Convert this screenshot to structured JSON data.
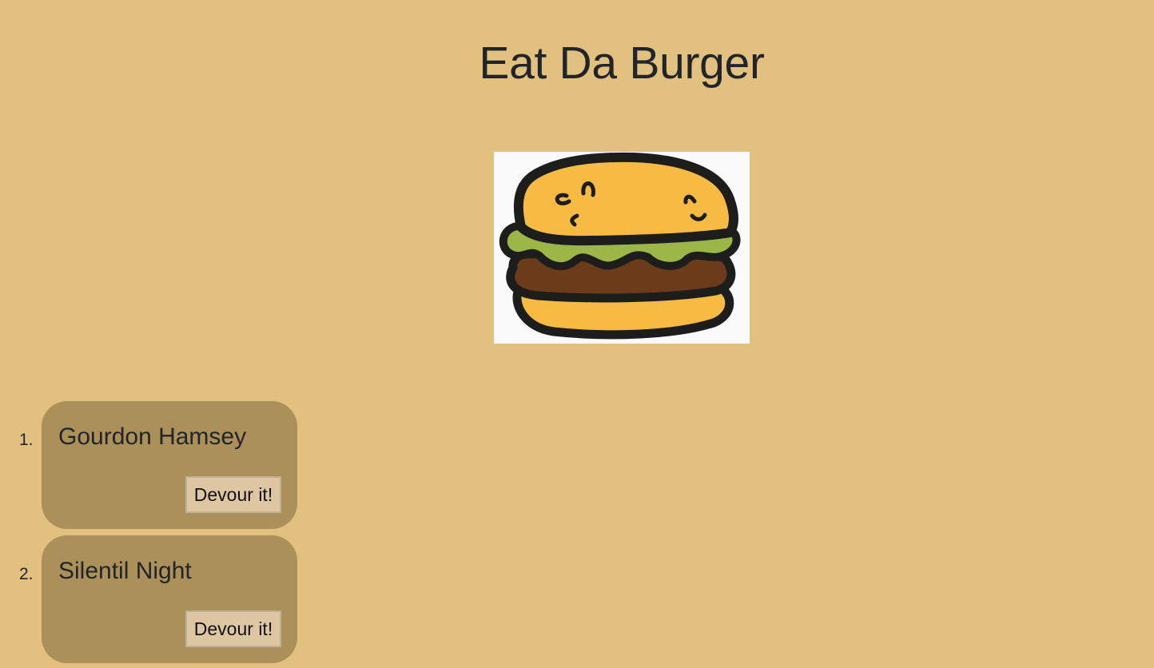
{
  "page": {
    "title": "Eat Da Burger",
    "background_color": "#e1c080"
  },
  "hero_image": {
    "icon": "burger-illustration-icon"
  },
  "burgers": [
    {
      "number": "1.",
      "name": "Gourdon Hamsey",
      "button_label": "Devour it!"
    },
    {
      "number": "2.",
      "name": "Silentil Night",
      "button_label": "Devour it!"
    }
  ],
  "colors": {
    "card": "#ab905a",
    "button": "#ddc6a1",
    "bun": "#f7bb43",
    "lettuce": "#9cb747",
    "patty": "#6c3c1a",
    "outline": "#1d1d1b"
  }
}
